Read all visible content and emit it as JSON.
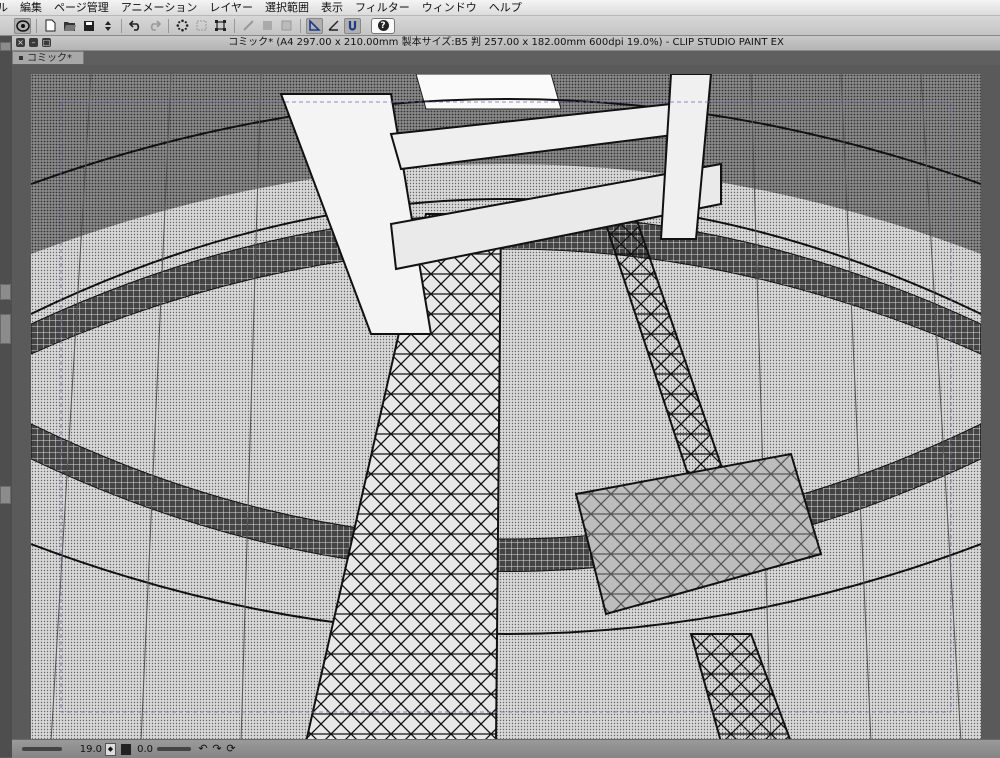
{
  "menu": {
    "items": [
      "ル",
      "編集",
      "ページ管理",
      "アニメーション",
      "レイヤー",
      "選択範囲",
      "表示",
      "フィルター",
      "ウィンドウ",
      "ヘルプ"
    ]
  },
  "toolbar": {
    "icons": [
      "app-logo-icon",
      "new-icon",
      "open-icon",
      "save-icon",
      "save-arrow-icon",
      "undo-icon",
      "redo-icon",
      "spinner-icon",
      "transform-icon",
      "crop-icon",
      "brush-cursor-icon",
      "layer-icon",
      "layer-mask-icon",
      "ruler-icon",
      "snap-ruler-icon",
      "snap-icon"
    ],
    "help_glyph": "?"
  },
  "window": {
    "title": "コミック* (A4 297.00 x 210.00mm 製本サイズ:B5 判 257.00 x 182.00mm 600dpi 19.0%)  - CLIP STUDIO PAINT EX",
    "tab_label": "コミック*",
    "close_glyph": "×",
    "minimize_glyph": "–",
    "maximize_glyph": "□"
  },
  "status": {
    "zoom": "19.0",
    "angle": "0.0"
  },
  "colors": {
    "menubar": "#e8e8e8",
    "toolbar": "#cccccc",
    "workspace": "#5a5a5a",
    "paper": "#ffffff",
    "ink": "#111111"
  }
}
